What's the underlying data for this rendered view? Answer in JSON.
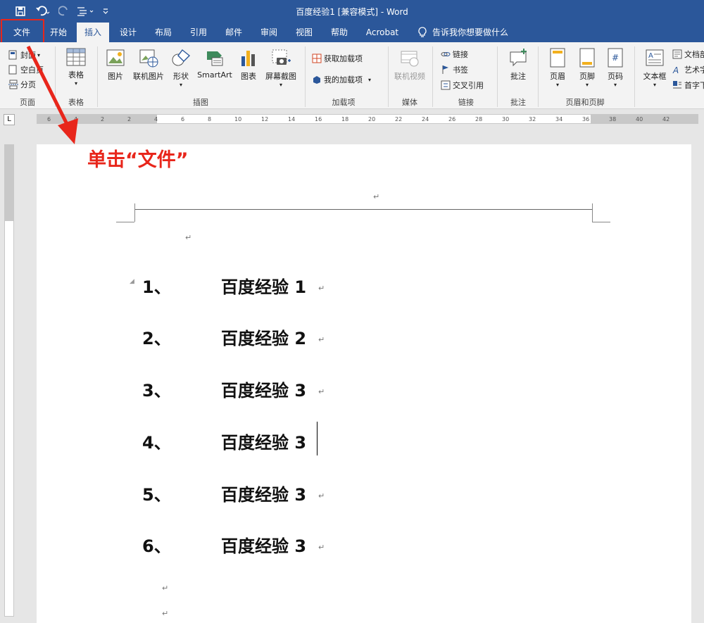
{
  "titlebar": {
    "title": "百度经验1 [兼容模式] - Word",
    "save_icon": "save-icon",
    "undo_icon": "undo-icon",
    "redo_icon": "redo-icon"
  },
  "tabs": [
    "文件",
    "开始",
    "插入",
    "设计",
    "布局",
    "引用",
    "邮件",
    "审阅",
    "视图",
    "帮助",
    "Acrobat"
  ],
  "tell_me": "告诉我你想要做什么",
  "ribbon": {
    "pages": {
      "cover": "封面",
      "blank": "空白页",
      "break": "分页",
      "group": "页面"
    },
    "tables": {
      "table": "表格",
      "group": "表格"
    },
    "illustrations": {
      "picture": "图片",
      "online_picture": "联机图片",
      "shapes": "形状",
      "smartart": "SmartArt",
      "chart": "图表",
      "screenshot": "屏幕截图",
      "group": "插图"
    },
    "addins": {
      "get": "获取加载项",
      "mine": "我的加载项",
      "group": "加载项"
    },
    "media": {
      "online_video": "联机视频",
      "group": "媒体"
    },
    "links": {
      "link": "链接",
      "bookmark": "书签",
      "cross_ref": "交叉引用",
      "group": "链接"
    },
    "comments": {
      "comment": "批注",
      "group": "批注"
    },
    "header_footer": {
      "header": "页眉",
      "footer": "页脚",
      "page_number": "页码",
      "group": "页眉和页脚"
    },
    "text": {
      "textbox": "文本框",
      "docparts": "文档部",
      "wordart": "艺术字",
      "dropcap": "首字下"
    }
  },
  "ruler": {
    "h_labels": [
      "6",
      "4",
      "2",
      "2",
      "4",
      "6",
      "8",
      "10",
      "12",
      "14",
      "16",
      "18",
      "20",
      "22",
      "24",
      "26",
      "28",
      "30",
      "32",
      "34",
      "36",
      "38",
      "40",
      "42"
    ]
  },
  "annotation": "单击“文件”",
  "list_items": [
    {
      "num": "1、",
      "text": "百度经验 1"
    },
    {
      "num": "2、",
      "text": "百度经验 2"
    },
    {
      "num": "3、",
      "text": "百度经验 3"
    },
    {
      "num": "4、",
      "text": "百度经验 3"
    },
    {
      "num": "5、",
      "text": "百度经验 3"
    },
    {
      "num": "6、",
      "text": "百度经验 3"
    }
  ],
  "paragraph_mark": "↵",
  "colors": {
    "brand": "#2b579a",
    "annotation": "#e8261b"
  }
}
